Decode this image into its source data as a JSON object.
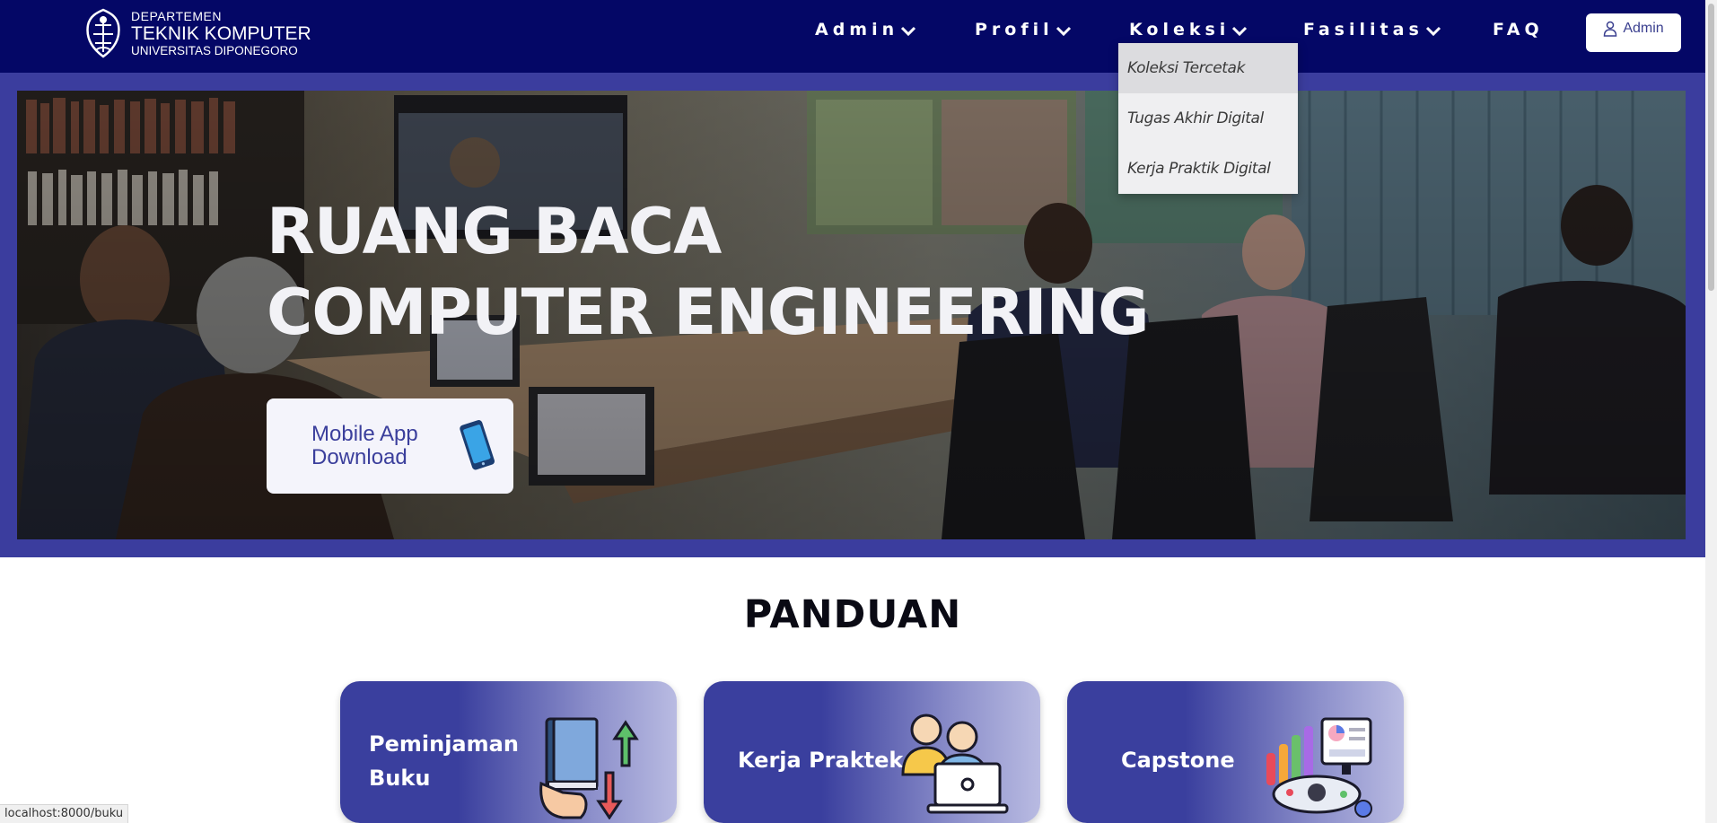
{
  "brand": {
    "line1": "DEPARTEMEN",
    "line2": "TEKNIK KOMPUTER",
    "line3": "UNIVERSITAS DIPONEGORO"
  },
  "nav": {
    "admin": "Admin",
    "profil": "Profil",
    "koleksi": "Koleksi",
    "fasilitas": "Fasilitas",
    "faq": "FAQ"
  },
  "admin_button": "Admin",
  "dropdown": {
    "items": [
      "Koleksi Tercetak",
      "Tugas Akhir Digital",
      "Kerja Praktik Digital"
    ]
  },
  "hero": {
    "title_line1": "RUANG BACA",
    "title_line2": "COMPUTER ENGINEERING",
    "app_line1": "Mobile App",
    "app_line2": "Download"
  },
  "panduan": {
    "title": "PANDUAN",
    "cards": [
      {
        "label": "Peminjaman Buku",
        "icon": "book-exchange-icon"
      },
      {
        "label": "Kerja Praktek",
        "icon": "people-laptop-icon"
      },
      {
        "label": "Capstone",
        "icon": "analytics-dashboard-icon"
      }
    ]
  },
  "status_url": "localhost:8000/buku",
  "colors": {
    "navbar": "#040766",
    "hero_frame": "#3b3d9e",
    "card_start": "#3a3f9e",
    "card_end": "#b9bbe2"
  }
}
